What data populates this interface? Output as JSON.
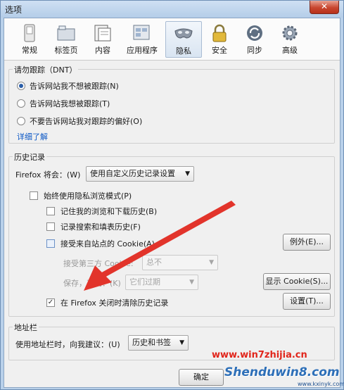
{
  "window": {
    "title": "选项",
    "close_label": "✕"
  },
  "toolbar": {
    "items": [
      {
        "label": "常规",
        "icon": "switch-icon"
      },
      {
        "label": "标签页",
        "icon": "folder-tabs-icon"
      },
      {
        "label": "内容",
        "icon": "page-icon"
      },
      {
        "label": "应用程序",
        "icon": "applications-icon"
      },
      {
        "label": "隐私",
        "icon": "mask-icon"
      },
      {
        "label": "安全",
        "icon": "padlock-icon"
      },
      {
        "label": "同步",
        "icon": "sync-icon"
      },
      {
        "label": "高级",
        "icon": "gear-icon"
      }
    ],
    "active": "隐私"
  },
  "dnt": {
    "title": "请勿跟踪（DNT）",
    "options": [
      {
        "label": "告诉网站我不想被跟踪(N)",
        "selected": true
      },
      {
        "label": "告诉网站我想被跟踪(T)",
        "selected": false
      },
      {
        "label": "不要告诉网站我对跟踪的偏好(O)",
        "selected": false
      }
    ],
    "learn_more": "详细了解"
  },
  "history": {
    "title": "历史记录",
    "firefox_will_label": "Firefox 将会：(W)",
    "firefox_will_value": "使用自定义历史记录设置",
    "private_mode": {
      "label": "始终使用隐私浏览模式(P)",
      "checked": false
    },
    "remember_browse": {
      "label": "记住我的浏览和下载历史(B)",
      "checked": false
    },
    "remember_search": {
      "label": "记录搜索和填表历史(F)",
      "checked": false
    },
    "accept_cookies": {
      "label": "接受来自站点的 Cookie(A)",
      "checked": false
    },
    "exceptions_button": "例外(E)...",
    "third_party_label": "接受第三方 Cookie:",
    "third_party_value": "总不",
    "keep_until_label": "保存，直到：(K)",
    "keep_until_value": "它们过期",
    "show_cookies_button": "显示 Cookie(S)...",
    "clear_on_close": {
      "label": "在 Firefox 关闭时清除历史记录",
      "checked": true,
      "mark": "✓"
    },
    "settings_button": "设置(T)..."
  },
  "locationbar": {
    "title": "地址栏",
    "suggest_label": "使用地址栏时，向我建议：(U)",
    "suggest_value": "历史和书签"
  },
  "footer": {
    "ok_button": "确定"
  },
  "watermark": {
    "line1": "www.win7zhijia.cn",
    "line2": "Shenduwin8.com",
    "line3": "www.kxinyk.com"
  },
  "colors": {
    "arrow": "#e2342b",
    "link": "#0b57c5",
    "accent": "#2a5ea8"
  }
}
